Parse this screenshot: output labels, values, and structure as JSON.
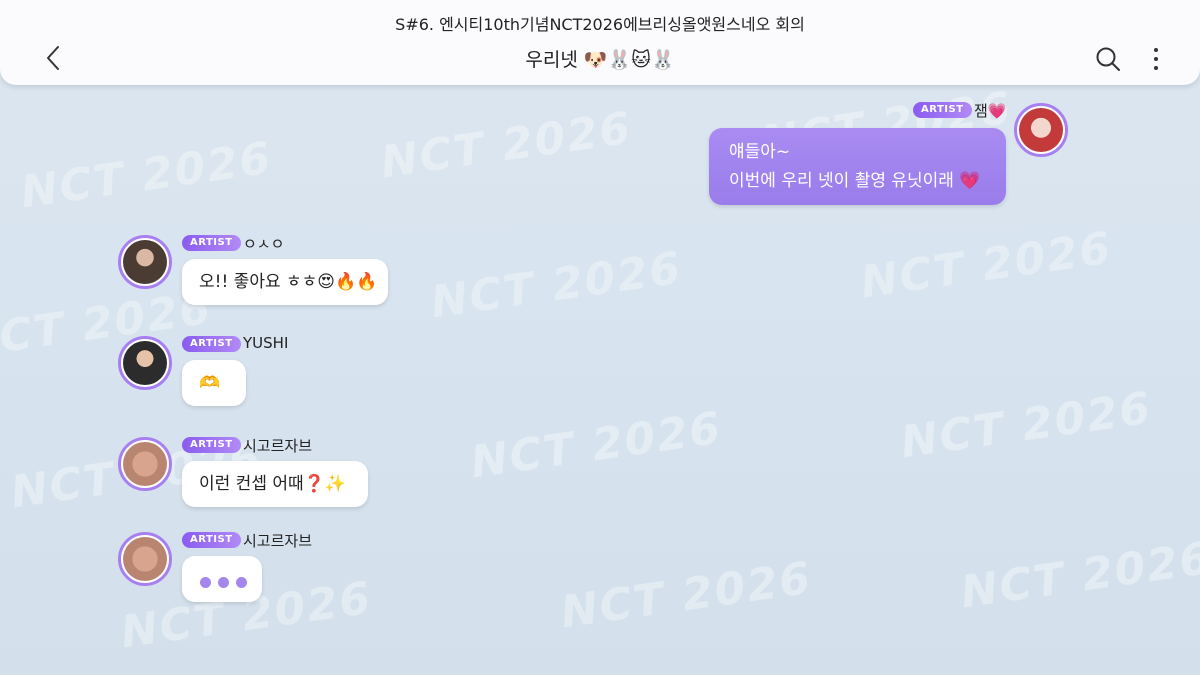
{
  "header": {
    "scene_title": "S#6. 엔시티10th기념NCT2026에브리싱올앳원스네오 회의",
    "room_title": "우리넷 🐶🐰🐱🐰"
  },
  "messages": [
    {
      "sender": "잼💗",
      "badge": "ARTIST",
      "lines": [
        "얘들아~",
        "이번에 우리 넷이 촬영 유닛이래 💗"
      ]
    },
    {
      "sender": "ㅇㅅㅇ",
      "badge": "ARTIST",
      "text": "오!! 좋아요 ㅎㅎ😍🔥🔥"
    },
    {
      "sender": "YUSHI",
      "badge": "ARTIST",
      "text": "🫶"
    },
    {
      "sender": "시고르자브",
      "badge": "ARTIST",
      "text": "이런 컨셉 어때❓✨"
    },
    {
      "sender": "시고르자브",
      "badge": "ARTIST",
      "typing": true
    }
  ],
  "watermark": "NCT 2026",
  "colors": {
    "accent": "#9a7ceb",
    "badge": "#8a5cf0",
    "background": "#d8e4ef"
  }
}
